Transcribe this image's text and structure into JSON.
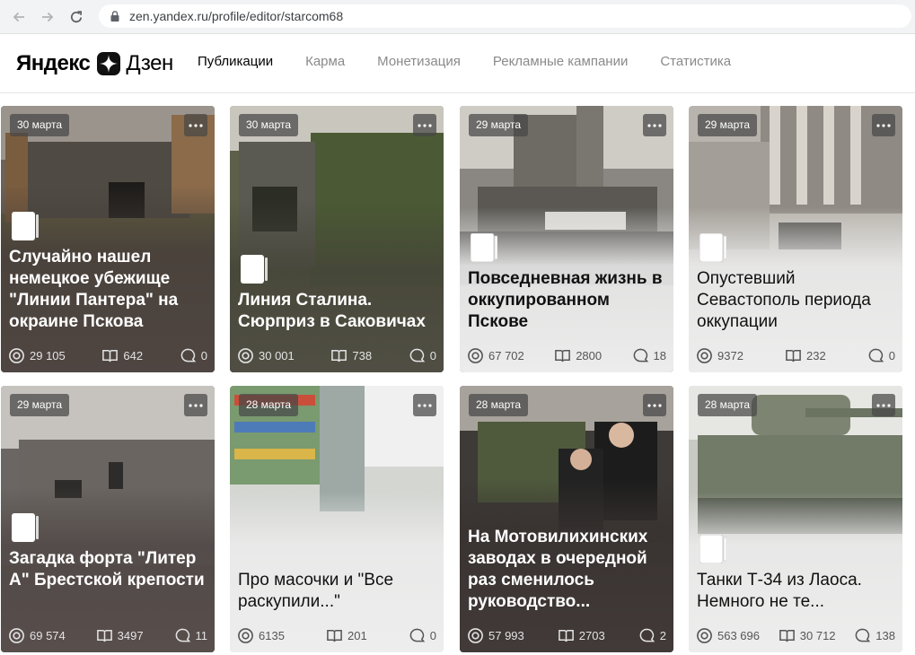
{
  "browser": {
    "url": "zen.yandex.ru/profile/editor/starcom68"
  },
  "header": {
    "logo_yandex": "Яндекс",
    "logo_dzen": "Дзен",
    "nav": [
      {
        "label": "Публикации",
        "active": true
      },
      {
        "label": "Карма",
        "active": false
      },
      {
        "label": "Монетизация",
        "active": false
      },
      {
        "label": "Рекламные кампании",
        "active": false
      },
      {
        "label": "Статистика",
        "active": false
      }
    ]
  },
  "cards": [
    {
      "date": "30 марта",
      "title": "Случайно нашел немецкое убежище \"Линии Пантера\" на окраине Пскова",
      "views": "29 105",
      "reads": "642",
      "comments": "0",
      "theme": "dark"
    },
    {
      "date": "30 марта",
      "title": "Линия Сталина. Сюрприз в Саковичах",
      "views": "30 001",
      "reads": "738",
      "comments": "0",
      "theme": "dark"
    },
    {
      "date": "29 марта",
      "title": "Повседневная жизнь в оккупированном Пскове",
      "views": "67 702",
      "reads": "2800",
      "comments": "18",
      "theme": "light"
    },
    {
      "date": "29 марта",
      "title": "Опустевший Севастополь периода оккупации",
      "views": "9372",
      "reads": "232",
      "comments": "0",
      "theme": "light"
    },
    {
      "date": "29 марта",
      "title": "Загадка форта \"Литер А\" Брестской крепости",
      "views": "69 574",
      "reads": "3497",
      "comments": "11",
      "theme": "dark"
    },
    {
      "date": "28 марта",
      "title": "Про масочки и \"Все раскупили...\"",
      "views": "6135",
      "reads": "201",
      "comments": "0",
      "theme": "light"
    },
    {
      "date": "28 марта",
      "title": "На Мотовилихинских заводах в очередной раз сменилось руководство...",
      "views": "57 993",
      "reads": "2703",
      "comments": "2",
      "theme": "dark"
    },
    {
      "date": "28 марта",
      "title": "Танки Т-34 из Лаоса. Немного не те...",
      "views": "563 696",
      "reads": "30 712",
      "comments": "138",
      "theme": "light"
    }
  ]
}
